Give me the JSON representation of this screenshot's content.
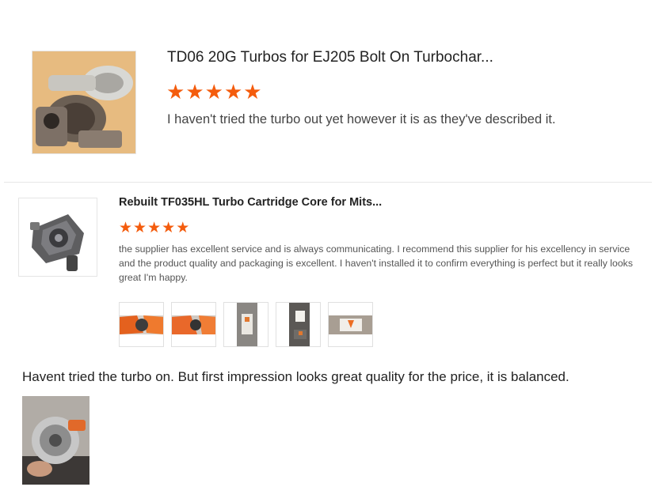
{
  "reviews": [
    {
      "product_title": "TD06 20G Turbos for EJ205 Bolt On Turbochar...",
      "rating": 5,
      "stars": "★★★★★",
      "text": "I haven't tried the turbo out yet however it is as they've described it."
    },
    {
      "product_title": "Rebuilt TF035HL Turbo Cartridge Core for Mits...",
      "rating": 5,
      "stars": "★★★★★",
      "text": "the supplier has excellent service and is always communicating. I recommend this supplier for his excellency in service and the product quality and packaging is excellent. I haven't installed it to confirm everything is perfect but it really looks great I'm happy.",
      "photo_count": 5
    },
    {
      "text": "Havent tried the turbo on. But first impression looks great quality for the price, it is balanced."
    }
  ],
  "colors": {
    "star": "#f45c0d",
    "divider": "#e6e6e6"
  }
}
